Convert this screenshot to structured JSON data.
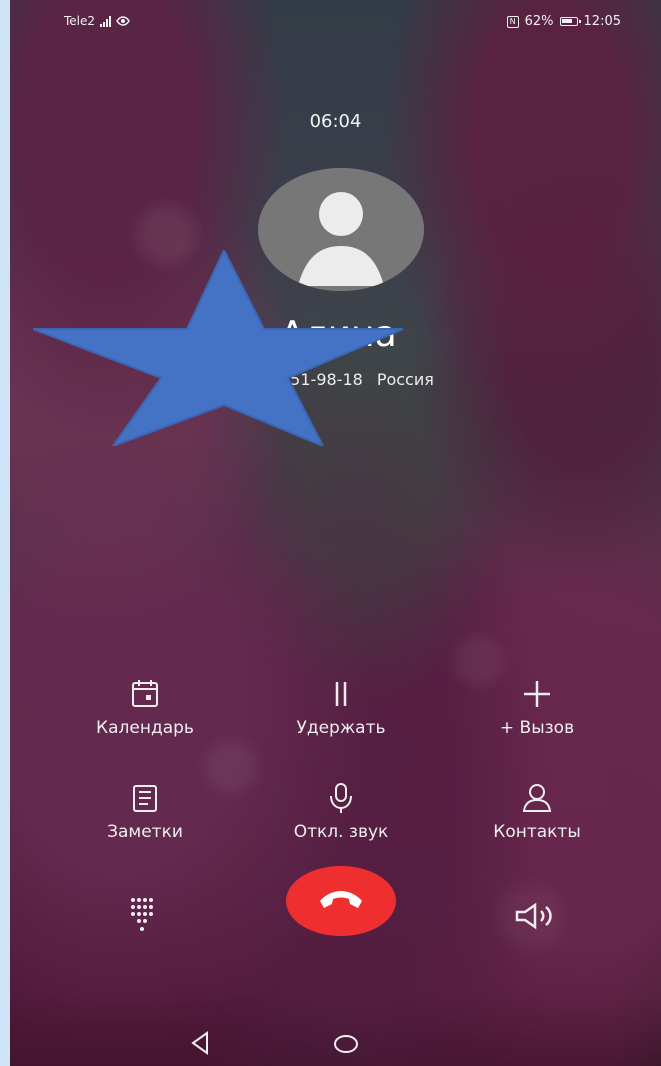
{
  "status_bar": {
    "carrier": "Tele2",
    "battery": "62%",
    "time": "12:05"
  },
  "call": {
    "duration": "06:04",
    "name_visible": "Алина",
    "number_partial": "751-98-18",
    "country": "Россия"
  },
  "controls": {
    "calendar": "Календарь",
    "hold": "Удержать",
    "add_call": "+ Вызов",
    "notes": "Заметки",
    "mute": "Откл. звук",
    "contacts": "Контакты"
  },
  "icons": {
    "eye": "eye-icon",
    "nfc": "nfc-icon",
    "battery": "battery-icon",
    "calendar": "calendar-icon",
    "hold": "pause-icon",
    "add": "plus-icon",
    "notes": "note-icon",
    "mute": "microphone-icon",
    "contacts": "person-icon",
    "dialpad": "dialpad-icon",
    "end_call": "phone-hangup-icon",
    "speaker": "speaker-icon",
    "back": "back-icon",
    "home": "home-icon"
  },
  "colors": {
    "end_call": "#ef2f2f",
    "text": "#f2f2f2",
    "star": "#4472c4"
  }
}
